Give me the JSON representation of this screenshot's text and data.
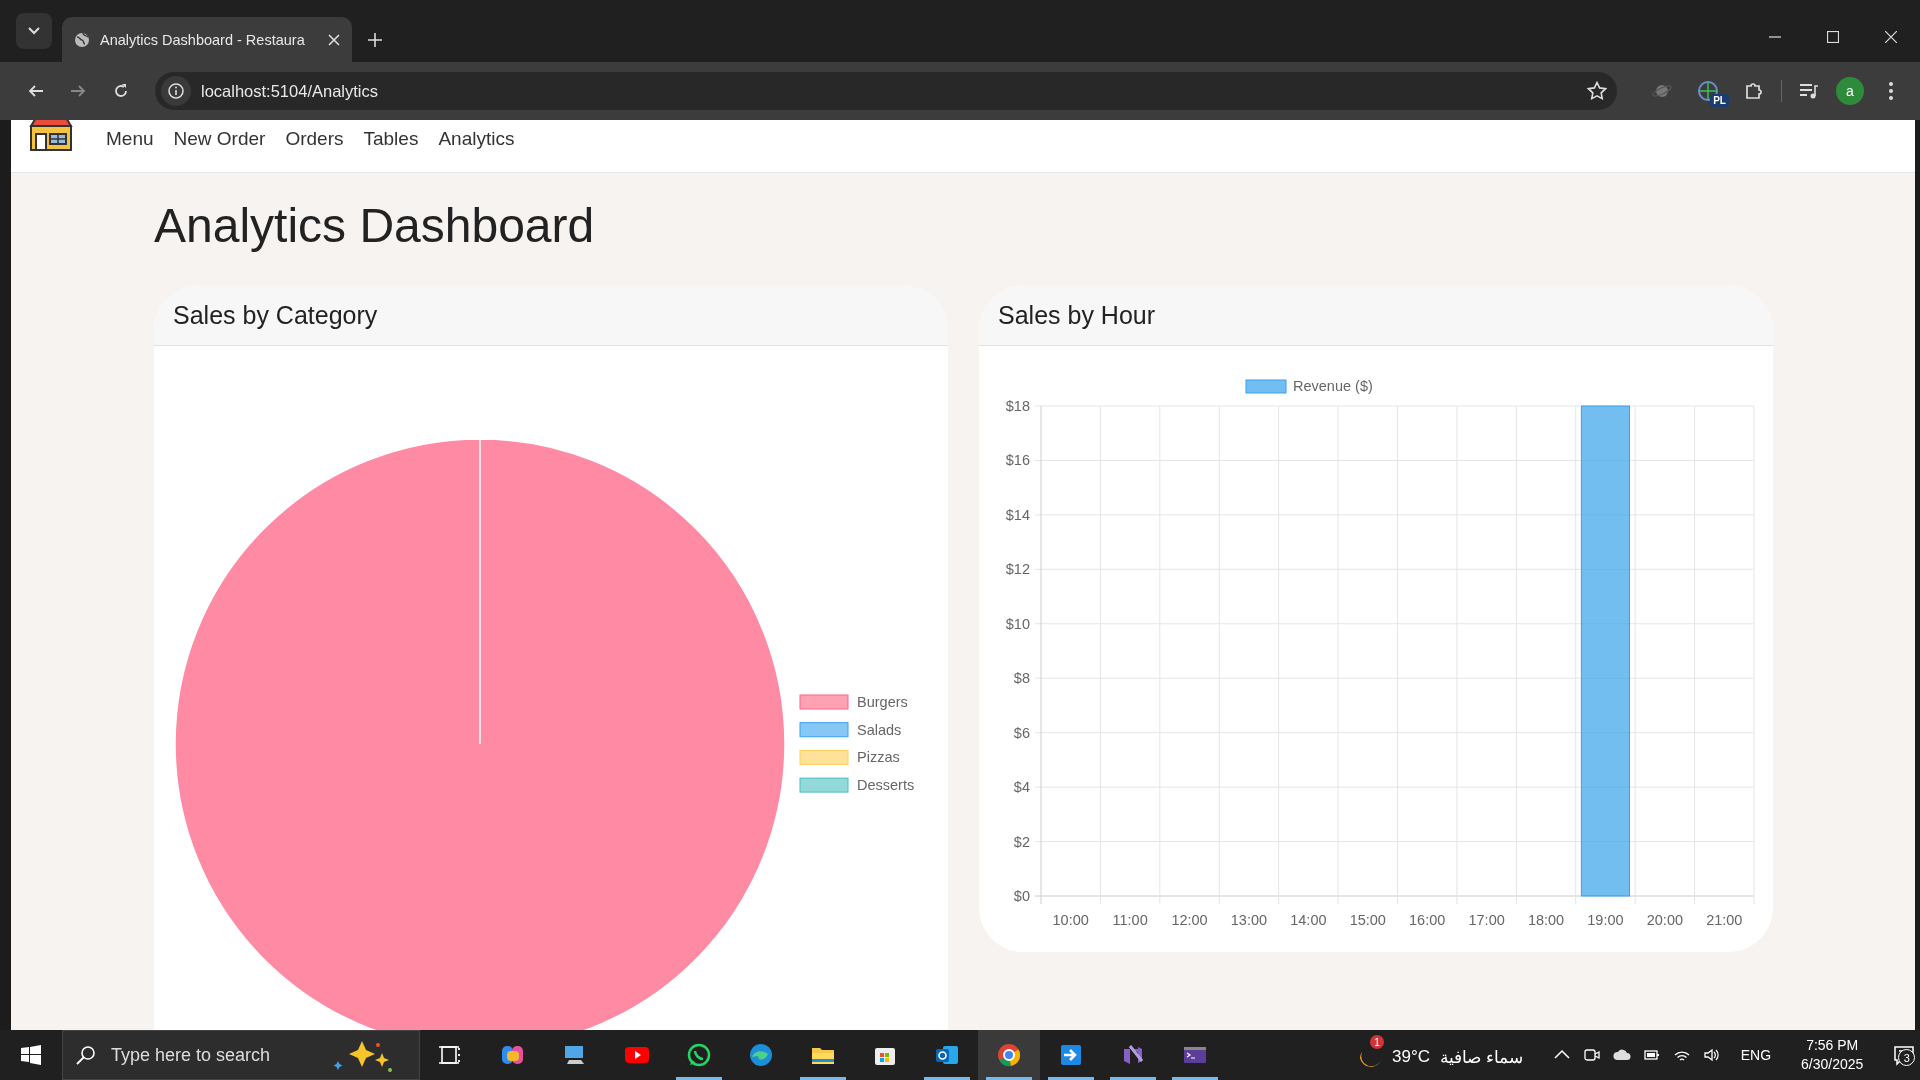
{
  "browser": {
    "tab_title": "Analytics Dashboard - Restaura",
    "address": "localhost:5104/Analytics",
    "extension_badge": "PL",
    "profile_initial": "a"
  },
  "nav": {
    "items": [
      "Menu",
      "New Order",
      "Orders",
      "Tables",
      "Analytics"
    ]
  },
  "heading": "Analytics Dashboard",
  "cards": [
    {
      "title": "Sales by Category",
      "chart_data": {
        "type": "pie",
        "categories": [
          "Burgers",
          "Salads",
          "Pizzas",
          "Desserts"
        ],
        "colors": [
          "#ff6384",
          "#36a2eb",
          "#ffce56",
          "#4bc0c0"
        ],
        "values": [
          100,
          0,
          0,
          0
        ]
      }
    },
    {
      "title": "Sales by Hour",
      "chart_data": {
        "type": "bar",
        "categories": [
          "10:00",
          "11:00",
          "12:00",
          "13:00",
          "14:00",
          "15:00",
          "16:00",
          "17:00",
          "18:00",
          "19:00",
          "20:00",
          "21:00"
        ],
        "series": [
          {
            "name": "Revenue ($)",
            "color": "#36a2eb",
            "values": [
              0,
              0,
              0,
              0,
              0,
              0,
              0,
              0,
              0,
              18,
              0,
              0
            ]
          }
        ],
        "grid": true,
        "ylim": [
          0,
          18
        ],
        "yticks": [
          {
            "value": 0,
            "label": "$0"
          },
          {
            "value": 2,
            "label": "$2"
          },
          {
            "value": 4,
            "label": "$4"
          },
          {
            "value": 6,
            "label": "$6"
          },
          {
            "value": 8,
            "label": "$8"
          },
          {
            "value": 10,
            "label": "$10"
          },
          {
            "value": 12,
            "label": "$12"
          },
          {
            "value": 14,
            "label": "$14"
          },
          {
            "value": 16,
            "label": "$16"
          },
          {
            "value": 18,
            "label": "$18"
          }
        ]
      }
    }
  ],
  "taskbar": {
    "search_placeholder": "Type here to search",
    "apps": [
      {
        "kind": "taskview",
        "running": false,
        "selected": false
      },
      {
        "kind": "swirl",
        "running": false,
        "selected": false
      },
      {
        "kind": "monitor",
        "running": false,
        "selected": false
      },
      {
        "kind": "play",
        "running": false,
        "selected": false
      },
      {
        "kind": "chat",
        "running": true,
        "selected": false
      },
      {
        "kind": "wave",
        "running": false,
        "selected": false
      },
      {
        "kind": "folder",
        "running": true,
        "selected": false
      },
      {
        "kind": "bag",
        "running": false,
        "selected": false
      },
      {
        "kind": "mail",
        "running": true,
        "selected": false
      },
      {
        "kind": "circle",
        "running": true,
        "selected": true
      },
      {
        "kind": "arrow",
        "running": true,
        "selected": false
      },
      {
        "kind": "ribbon",
        "running": true,
        "selected": false
      },
      {
        "kind": "terminal",
        "running": true,
        "selected": false
      }
    ],
    "weather": {
      "badge": "1",
      "temperature": "39°C",
      "condition": "سماء صافية"
    },
    "language": "ENG",
    "time": "7:56 PM",
    "date": "6/30/2025",
    "notifications": "3"
  }
}
